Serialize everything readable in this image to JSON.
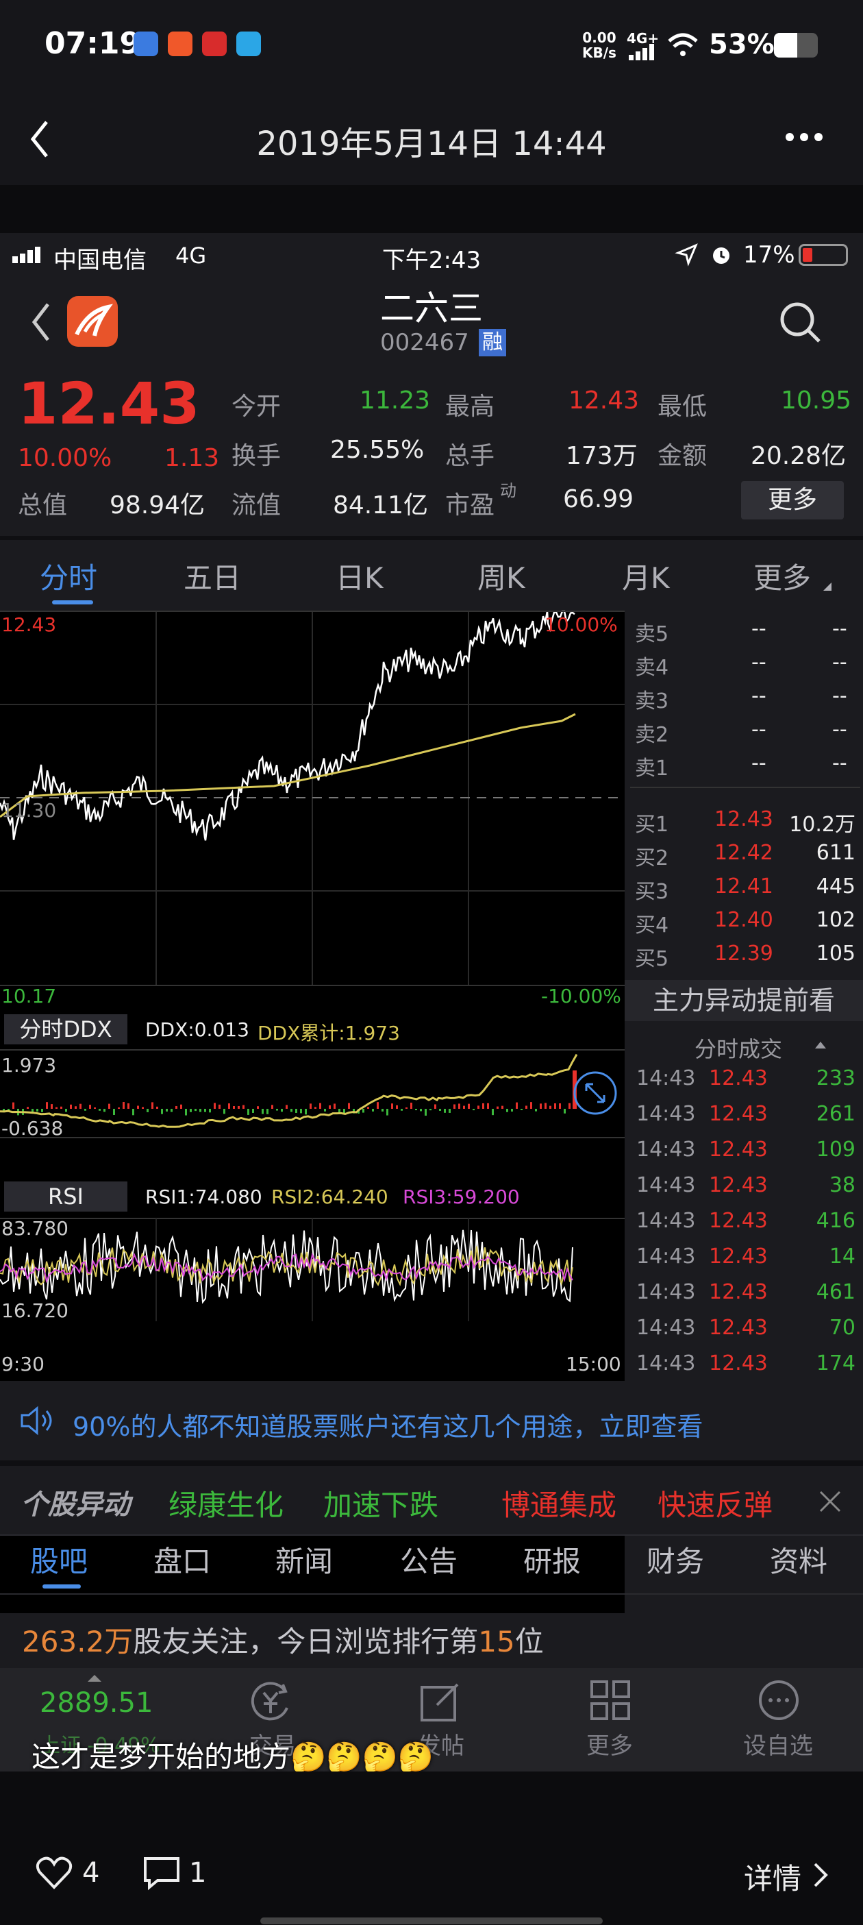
{
  "outer_status": {
    "time": "07:19",
    "net_speed_top": "0.00",
    "net_speed_unit": "KB/s",
    "network": "4G+",
    "battery": "53%"
  },
  "outer_header": {
    "title": "2019年5月14日 14:44"
  },
  "inner_status": {
    "carrier": "中国电信",
    "network": "4G",
    "time": "下午2:43",
    "battery": "17%"
  },
  "stock": {
    "name": "二六三",
    "code": "002467",
    "margin_badge": "融",
    "price": "12.43",
    "change_pct": "10.00%",
    "change": "1.13",
    "open_label": "今开",
    "open": "11.23",
    "high_label": "最高",
    "high": "12.43",
    "low_label": "最低",
    "low": "10.95",
    "turnover_label": "换手",
    "turnover": "25.55%",
    "volume_label": "总手",
    "volume": "173万",
    "amount_label": "金额",
    "amount": "20.28亿",
    "mktcap_label": "总值",
    "mktcap": "98.94亿",
    "float_label": "流值",
    "float": "84.11亿",
    "pe_label": "市盈",
    "pe_sup": "动",
    "pe": "66.99",
    "more_button": "更多"
  },
  "chart_tabs": [
    "分时",
    "五日",
    "日K",
    "周K",
    "月K",
    "更多"
  ],
  "chart_labels": {
    "price_high": "12.43",
    "price_low": "10.17",
    "pct_high": "10.00%",
    "pct_low": "-10.00%",
    "mid": "11.30",
    "time_start": "9:30",
    "time_end": "15:00"
  },
  "ddx": {
    "tab": "分时DDX",
    "ddx_text": "DDX:0.013",
    "ddx_cum": "DDX累计:1.973",
    "top": "1.973",
    "bottom": "-0.638"
  },
  "rsi": {
    "tab": "RSI",
    "rsi1": "RSI1:74.080",
    "rsi2": "RSI2:64.240",
    "rsi3": "RSI3:59.200",
    "top": "83.780",
    "bottom": "16.720"
  },
  "orderbook": {
    "sells": [
      {
        "label": "卖5",
        "price": "--",
        "vol": "--"
      },
      {
        "label": "卖4",
        "price": "--",
        "vol": "--"
      },
      {
        "label": "卖3",
        "price": "--",
        "vol": "--"
      },
      {
        "label": "卖2",
        "price": "--",
        "vol": "--"
      },
      {
        "label": "卖1",
        "price": "--",
        "vol": "--"
      }
    ],
    "buys": [
      {
        "label": "买1",
        "price": "12.43",
        "vol": "10.2万"
      },
      {
        "label": "买2",
        "price": "12.42",
        "vol": "611"
      },
      {
        "label": "买3",
        "price": "12.41",
        "vol": "445"
      },
      {
        "label": "买4",
        "price": "12.40",
        "vol": "102"
      },
      {
        "label": "买5",
        "price": "12.39",
        "vol": "105"
      }
    ],
    "promo": "主力异动提前看",
    "trades_header": "分时成交",
    "trades": [
      {
        "time": "14:43",
        "price": "12.43",
        "vol": "233"
      },
      {
        "time": "14:43",
        "price": "12.43",
        "vol": "261"
      },
      {
        "time": "14:43",
        "price": "12.43",
        "vol": "109"
      },
      {
        "time": "14:43",
        "price": "12.43",
        "vol": "38"
      },
      {
        "time": "14:43",
        "price": "12.43",
        "vol": "416"
      },
      {
        "time": "14:43",
        "price": "12.43",
        "vol": "14"
      },
      {
        "time": "14:43",
        "price": "12.43",
        "vol": "461"
      },
      {
        "time": "14:43",
        "price": "12.43",
        "vol": "70"
      },
      {
        "time": "14:43",
        "price": "12.43",
        "vol": "174"
      }
    ]
  },
  "notice": {
    "text": "90%的人都不知道股票账户还有这几个用途，立即查看"
  },
  "movers": {
    "title": "个股异动",
    "items": [
      "绿康生化",
      "加速下跌",
      "博通集成",
      "快速反弹"
    ]
  },
  "bottom_tabs": [
    "股吧",
    "盘口",
    "新闻",
    "公告",
    "研报",
    "财务",
    "资料"
  ],
  "followers": {
    "count": "263.2万",
    "text1": "股友关注，今日浏览排行第",
    "rank": "15",
    "text2": "位"
  },
  "bottom_nav": {
    "index_value": "2889.51",
    "index_sub": "上证 -0.49%",
    "items": [
      "交易",
      "发帖",
      "更多",
      "设自选"
    ]
  },
  "caption": "这才是梦开始的地方🤔🤔🤔🤔",
  "footer": {
    "likes": "4",
    "comments": "1",
    "detail": "详情"
  },
  "colors": {
    "red": "#e8312b",
    "green": "#3cb83c",
    "yellow": "#d8c857",
    "blue": "#4a8ee8"
  },
  "icons": {
    "back": "chevron-left-icon",
    "more": "more-dots-icon",
    "search": "search-icon",
    "speaker": "speaker-icon",
    "close": "close-icon",
    "heart": "heart-icon",
    "comment": "comment-icon",
    "location": "location-arrow-icon",
    "alarm": "alarm-icon"
  }
}
